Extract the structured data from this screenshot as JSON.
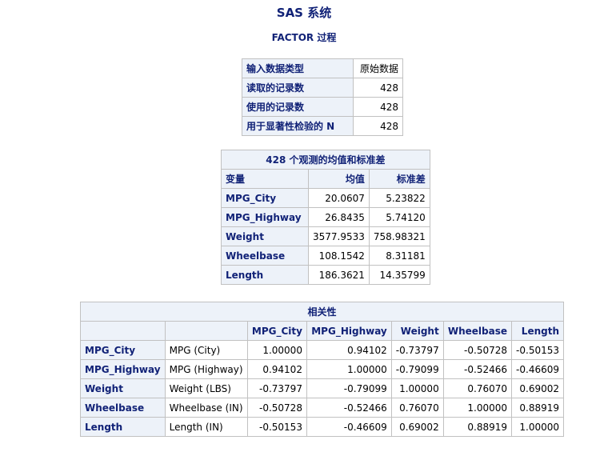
{
  "title": "SAS 系统",
  "procedure": "FACTOR 过程",
  "summary_table": {
    "rows": [
      {
        "label": "输入数据类型",
        "value": "原始数据"
      },
      {
        "label": "读取的记录数",
        "value": "428"
      },
      {
        "label": "使用的记录数",
        "value": "428"
      },
      {
        "label": "用于显著性检验的 N",
        "value": "428"
      }
    ]
  },
  "stats_table": {
    "caption": "428 个观测的均值和标准差",
    "headers": [
      "变量",
      "均值",
      "标准差"
    ],
    "rows": [
      {
        "var": "MPG_City",
        "mean": "20.0607",
        "std": "5.23822"
      },
      {
        "var": "MPG_Highway",
        "mean": "26.8435",
        "std": "5.74120"
      },
      {
        "var": "Weight",
        "mean": "3577.9533",
        "std": "758.98321"
      },
      {
        "var": "Wheelbase",
        "mean": "108.1542",
        "std": "8.31181"
      },
      {
        "var": "Length",
        "mean": "186.3621",
        "std": "14.35799"
      }
    ]
  },
  "corr_table": {
    "caption": "相关性",
    "columns": [
      "MPG_City",
      "MPG_Highway",
      "Weight",
      "Wheelbase",
      "Length"
    ],
    "rows": [
      {
        "var": "MPG_City",
        "label": "MPG (City)",
        "values": [
          "1.00000",
          "0.94102",
          "-0.73797",
          "-0.50728",
          "-0.50153"
        ]
      },
      {
        "var": "MPG_Highway",
        "label": "MPG (Highway)",
        "values": [
          "0.94102",
          "1.00000",
          "-0.79099",
          "-0.52466",
          "-0.46609"
        ]
      },
      {
        "var": "Weight",
        "label": "Weight (LBS)",
        "values": [
          "-0.73797",
          "-0.79099",
          "1.00000",
          "0.76070",
          "0.69002"
        ]
      },
      {
        "var": "Wheelbase",
        "label": "Wheelbase (IN)",
        "values": [
          "-0.50728",
          "-0.52466",
          "0.76070",
          "1.00000",
          "0.88919"
        ]
      },
      {
        "var": "Length",
        "label": "Length (IN)",
        "values": [
          "-0.50153",
          "-0.46609",
          "0.69002",
          "0.88919",
          "1.00000"
        ]
      }
    ]
  }
}
